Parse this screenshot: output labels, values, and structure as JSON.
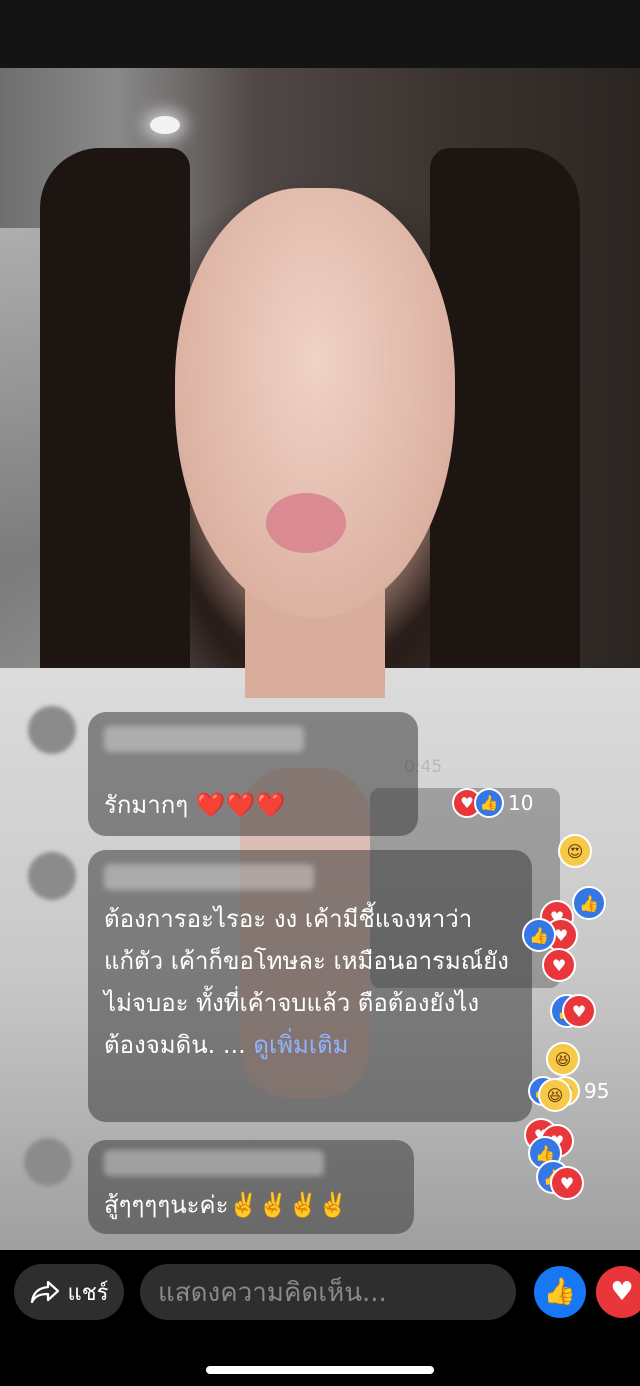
{
  "video": {
    "timer": "0:45"
  },
  "comments": [
    {
      "text": "รักมากๆ ❤️❤️❤️",
      "reactions": {
        "icons": [
          "love-icon",
          "like-icon"
        ],
        "count": "10"
      }
    },
    {
      "text": "ต้องการอะไรอะ งง เค้ามีชี้แจงหาว่าแก้ตัว เค้าก็ขอโทษละ เหมือนอารมณ์ยังไม่จบอะ ทั้งที่เค้าจบแล้ว ตือต้องยังไง ต้องจมดิน. ...",
      "see_more": "ดูเพิ่มเติม",
      "reactions": {
        "icons": [
          "like-icon",
          "haha-icon"
        ],
        "count": "95"
      }
    },
    {
      "text": "สู้ๆๆๆๆนะค่ะ✌️✌️✌️✌️"
    }
  ],
  "bottom_bar": {
    "share_label": "แชร์",
    "comment_placeholder": "แสดงความคิดเห็น...",
    "like_icon": "thumbs-up-icon",
    "love_icon": "heart-icon"
  },
  "colors": {
    "like_blue": "#1877f2",
    "love_red": "#e8363b",
    "link_blue": "#8fb4ff"
  }
}
